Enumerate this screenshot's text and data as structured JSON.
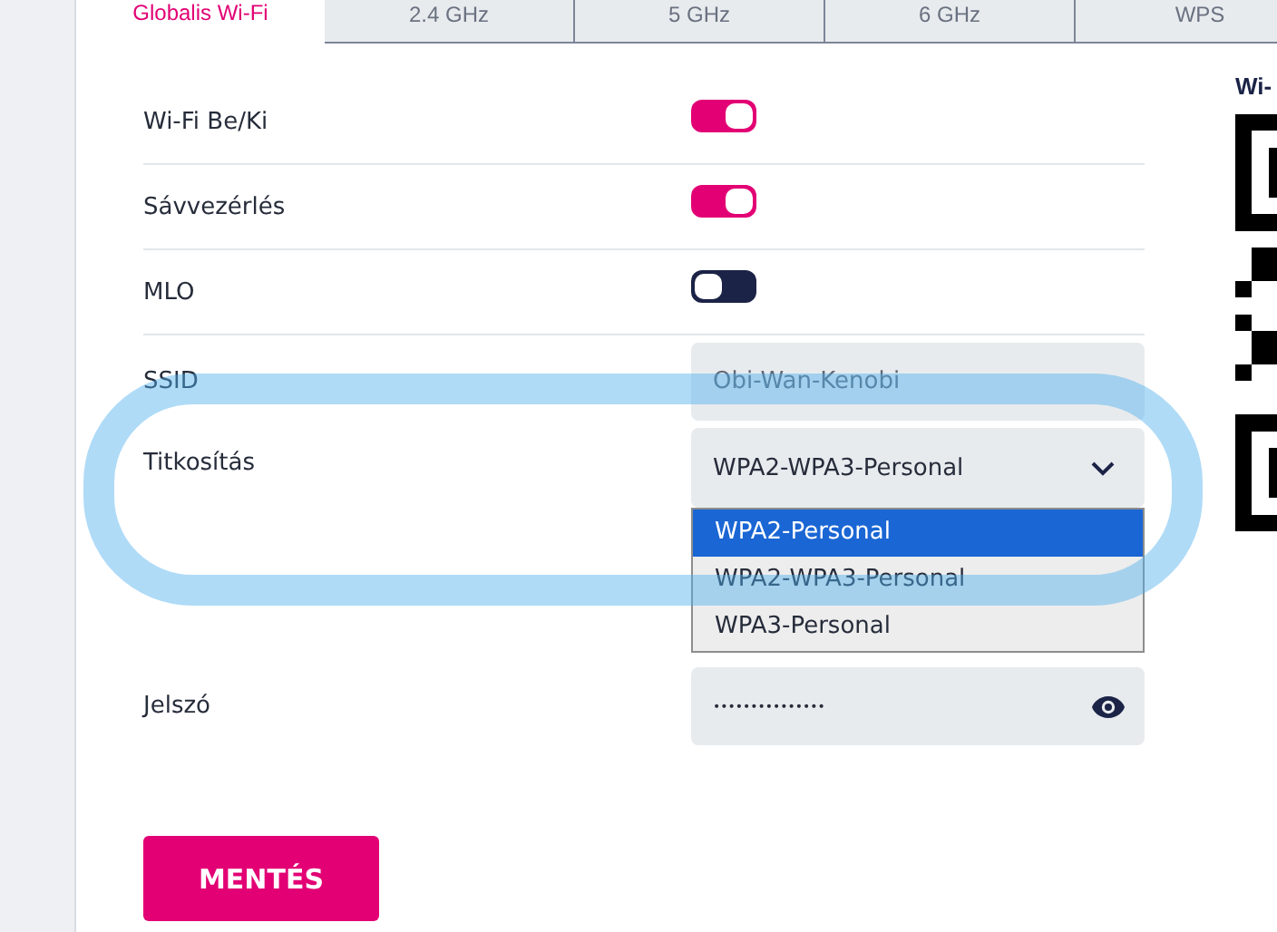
{
  "tabs": [
    {
      "label": "Globalis Wi-Fi",
      "selected": true
    },
    {
      "label": "2.4 GHz",
      "selected": false
    },
    {
      "label": "5 GHz",
      "selected": false
    },
    {
      "label": "6 GHz",
      "selected": false
    },
    {
      "label": "WPS",
      "selected": false
    }
  ],
  "settings": [
    {
      "kind": "toggle",
      "label": "Wi-Fi Be/Ki",
      "on": true
    },
    {
      "kind": "toggle",
      "label": "Sávvezérlés",
      "on": true
    },
    {
      "kind": "toggle",
      "label": "MLO",
      "on": false
    },
    {
      "kind": "text",
      "label": "SSID",
      "value": "Obi-Wan-Kenobi"
    },
    {
      "kind": "select",
      "label": "Titkosítás",
      "value": "WPA2-WPA3-Personal",
      "expanded": true,
      "options": [
        {
          "label": "WPA2-Personal",
          "highlighted": true
        },
        {
          "label": "WPA2-WPA3-Personal",
          "highlighted": false
        },
        {
          "label": "WPA3-Personal",
          "highlighted": false
        }
      ]
    },
    {
      "kind": "password",
      "label": "Jelszó",
      "value": "•••••••••••••••"
    }
  ],
  "qr": {
    "title": "Wi-"
  },
  "save_button": "MENTÉS"
}
